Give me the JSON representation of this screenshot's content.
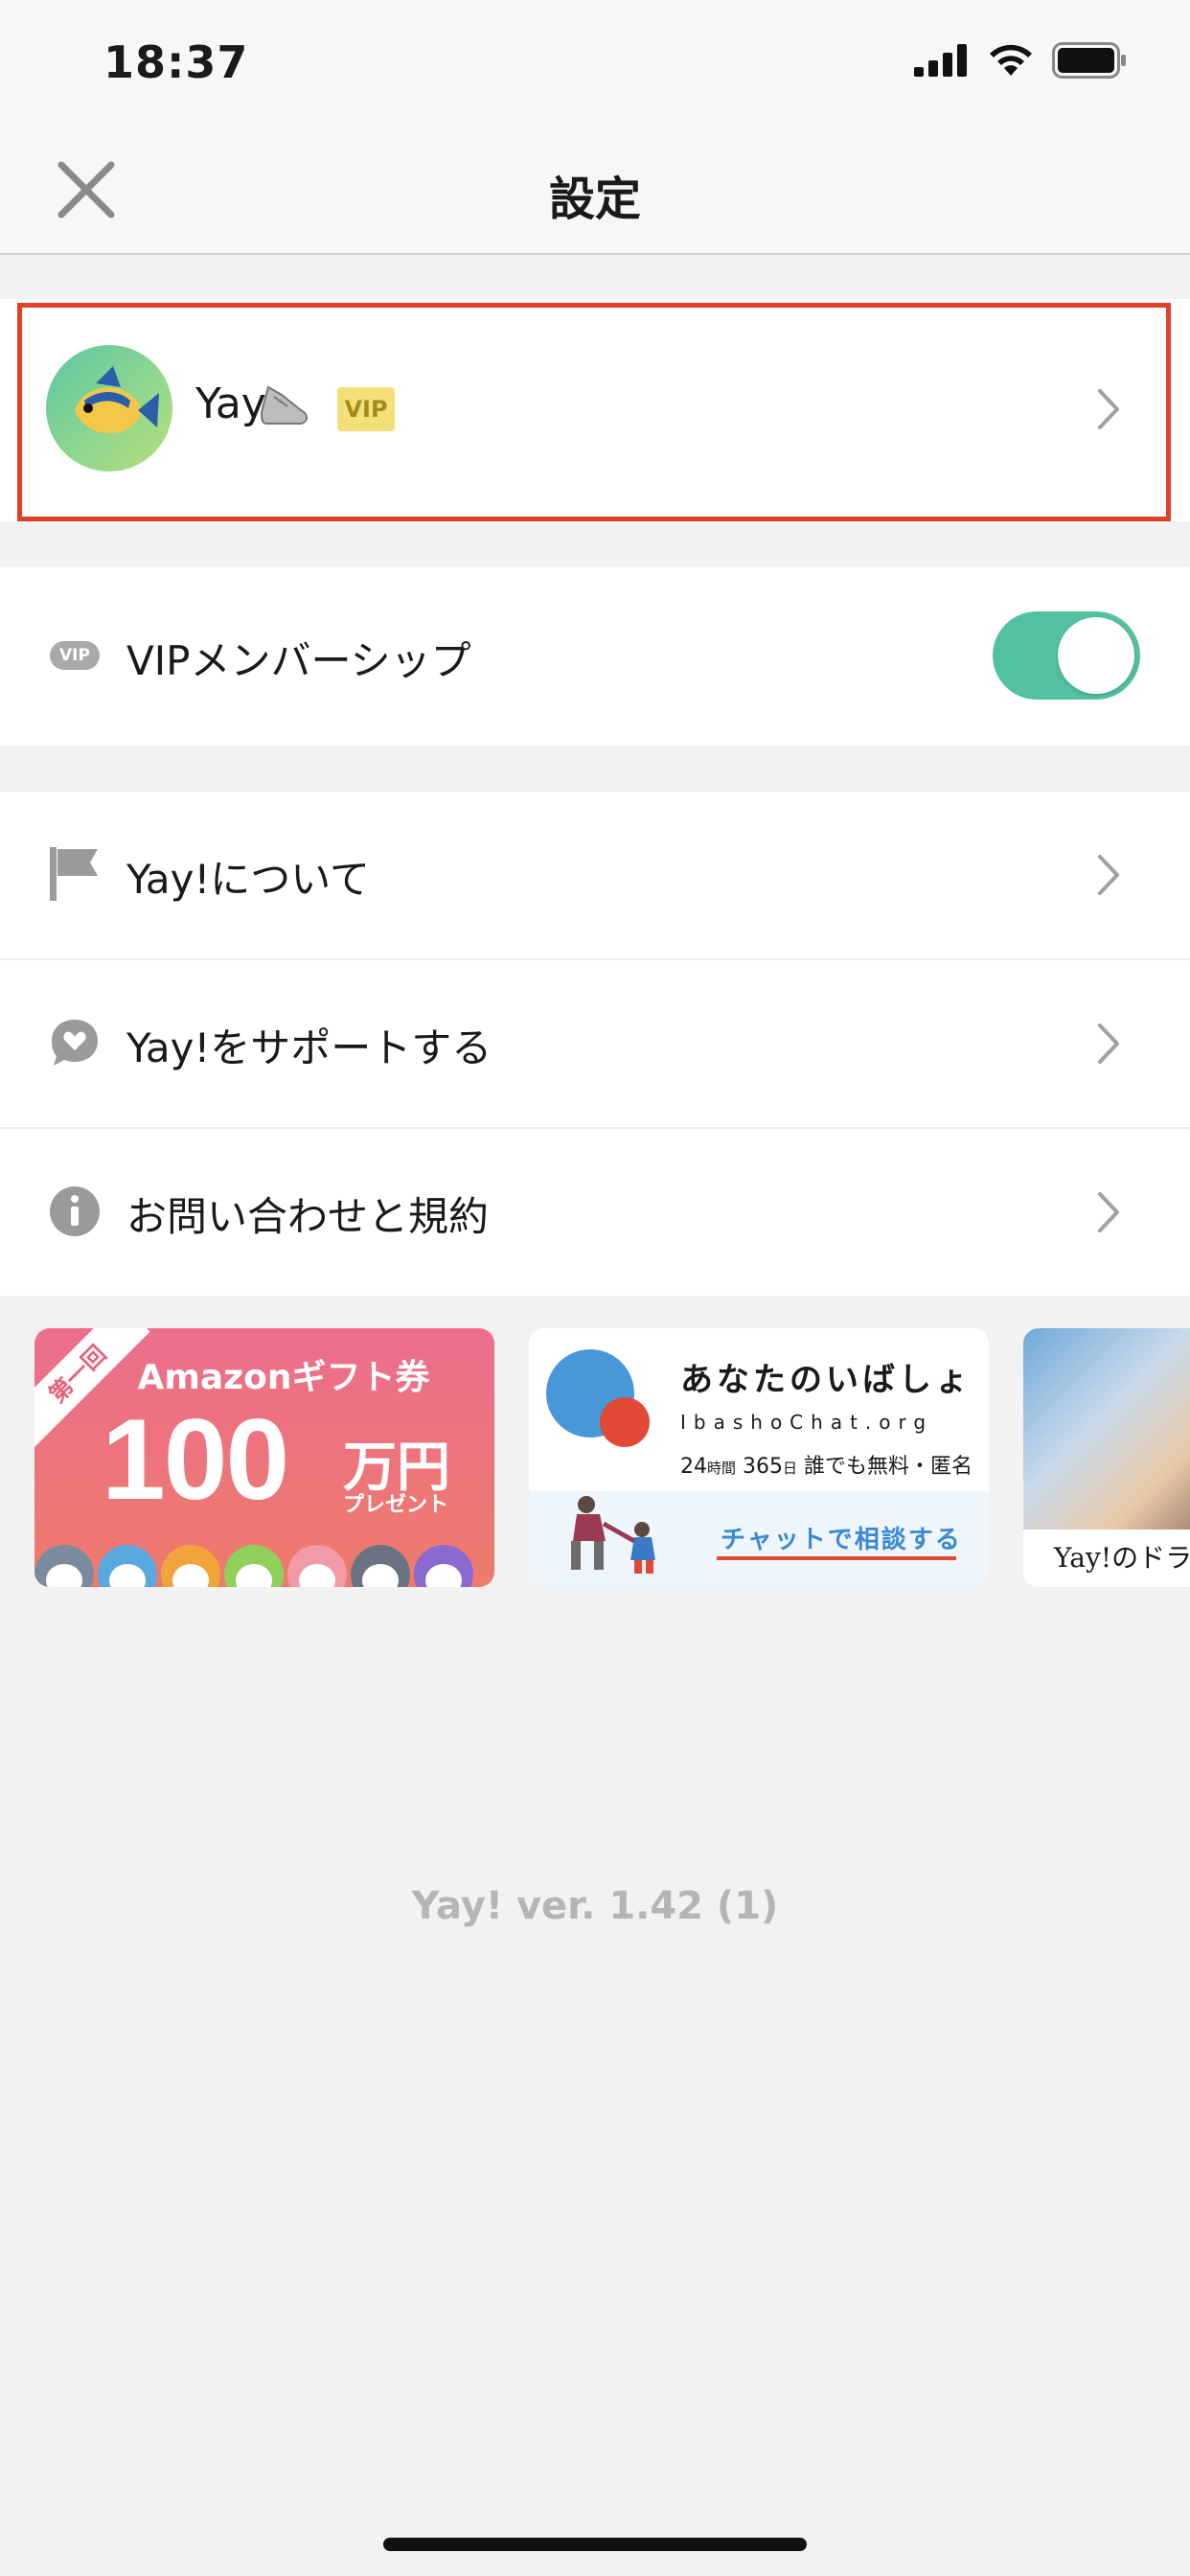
{
  "status_bar": {
    "time": "18:37"
  },
  "nav": {
    "title": "設定"
  },
  "profile": {
    "name": "Yay",
    "badge": "VIP"
  },
  "vip_membership": {
    "label": "VIPメンバーシップ",
    "chip": "VIP",
    "enabled": true
  },
  "menu_items": [
    {
      "label": "Yay!について",
      "icon": "flag-icon"
    },
    {
      "label": "Yay!をサポートする",
      "icon": "heart-bubble-icon"
    },
    {
      "label": "お問い合わせと規約",
      "icon": "info-icon"
    }
  ],
  "banners": {
    "amazon": {
      "ribbon": "第一回",
      "title": "Amazonギフト券",
      "amount": "100",
      "unit": "万円",
      "sub": "プレゼント"
    },
    "ibasho": {
      "title": "あなたのいばしょ",
      "url": "IbashoChat.org",
      "hours_num": "24",
      "hours_unit": "時間",
      "days_num": "365",
      "days_unit": "日",
      "sub": "誰でも無料・匿名",
      "cta": "チャットで相談する"
    },
    "drama": {
      "caption": "Yay!のドラ"
    }
  },
  "version": "Yay! ver. 1.42 (1)",
  "colors": {
    "accent": "#52c1a0",
    "highlight": "#e0402a"
  }
}
